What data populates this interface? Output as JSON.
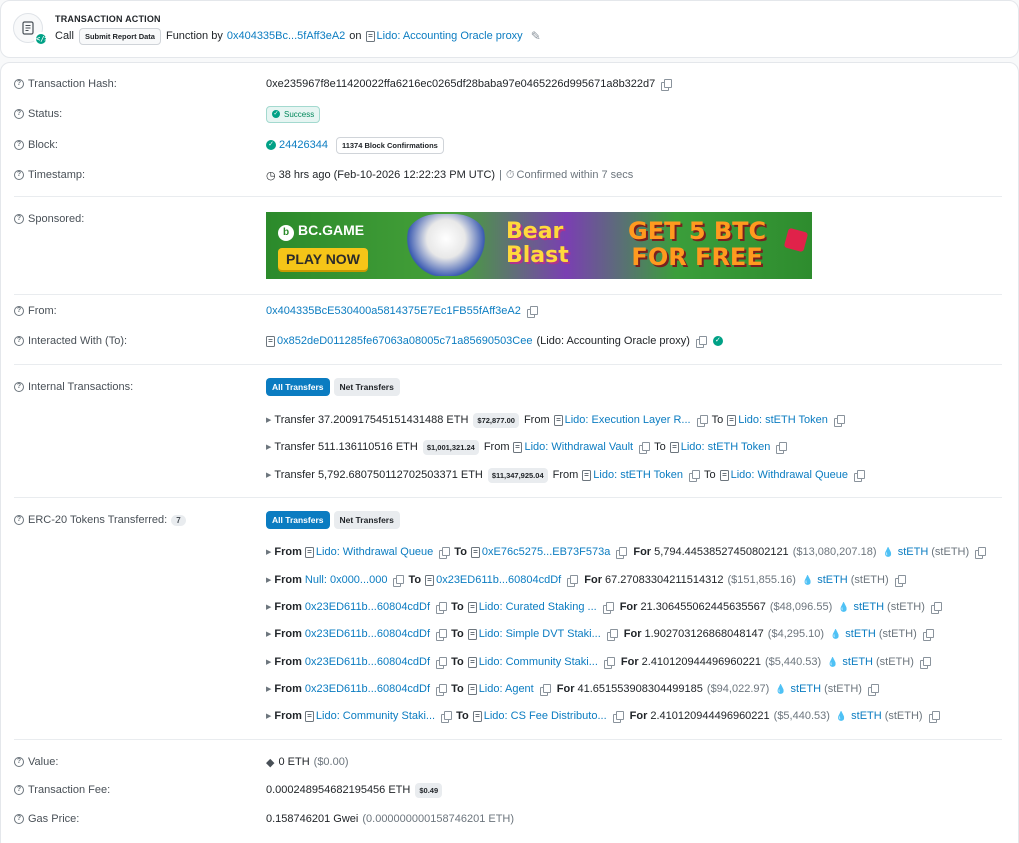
{
  "action": {
    "title": "TRANSACTION ACTION",
    "call": "Call",
    "method": "Submit Report Data",
    "function_by": "Function by",
    "from_addr": "0x404335Bc...5fAff3eA2",
    "on": "on",
    "contract": "Lido: Accounting Oracle proxy"
  },
  "labels": {
    "tx_hash": "Transaction Hash:",
    "status": "Status:",
    "block": "Block:",
    "timestamp": "Timestamp:",
    "sponsored": "Sponsored:",
    "from": "From:",
    "interacted": "Interacted With (To):",
    "internal": "Internal Transactions:",
    "erc20": "ERC-20 Tokens Transferred:",
    "value": "Value:",
    "fee": "Transaction Fee:",
    "gas": "Gas Price:"
  },
  "tx_hash": "0xe235967f8e11420022ffa6216ec0265df28baba97e0465226d995671a8b322d7",
  "status": "Success",
  "block": {
    "number": "24426344",
    "confirmations": "11374 Block Confirmations"
  },
  "timestamp": {
    "text": "38 hrs ago (Feb-10-2026 12:22:23 PM UTC)",
    "sep": "|",
    "confirmed": "Confirmed within 7 secs"
  },
  "ad": {
    "brand": "BC.GAME",
    "play": "PLAY NOW",
    "game_top": "Bear",
    "game_bottom": "Blast",
    "cta_1": "GET 5 BTC",
    "cta_2": "FOR FREE"
  },
  "from_address": "0x404335BcE530400a5814375E7Ec1FB55fAff3eA2",
  "to": {
    "address": "0x852deD011285fe67063a08005c71a85690503Cee",
    "name": "(Lido: Accounting Oracle proxy)"
  },
  "tabs": {
    "all": "All Transfers",
    "net": "Net Transfers"
  },
  "words": {
    "transfer": "Transfer",
    "from": "From",
    "to": "To",
    "for": "For"
  },
  "internal": [
    {
      "amount": "37.200917545151431488 ETH",
      "usd": "$72,877.00",
      "from": "Lido: Execution Layer R...",
      "to": "Lido: stETH Token"
    },
    {
      "amount": "511.136110516 ETH",
      "usd": "$1,001,321.24",
      "from": "Lido: Withdrawal Vault",
      "to": "Lido: stETH Token"
    },
    {
      "amount": "5,792.680750112702503371 ETH",
      "usd": "$11,347,925.04",
      "from": "Lido: stETH Token",
      "to": "Lido: Withdrawal Queue"
    }
  ],
  "erc20_count": "7",
  "erc20": [
    {
      "from": "Lido: Withdrawal Queue",
      "to": "0xE76c5275...EB73F573a",
      "amount": "5,794.44538527450802121",
      "usd": "($13,080,207.18)",
      "token": "stETH",
      "sym": "(stETH)"
    },
    {
      "from": "Null: 0x000...000",
      "to": "0x23ED611b...60804cdDf",
      "amount": "67.27083304211514312",
      "usd": "($151,855.16)",
      "token": "stETH",
      "sym": "(stETH)"
    },
    {
      "from": "0x23ED611b...60804cdDf",
      "to": "Lido: Curated Staking ...",
      "amount": "21.306455062445635567",
      "usd": "($48,096.55)",
      "token": "stETH",
      "sym": "(stETH)"
    },
    {
      "from": "0x23ED611b...60804cdDf",
      "to": "Lido: Simple DVT Staki...",
      "amount": "1.902703126868048147",
      "usd": "($4,295.10)",
      "token": "stETH",
      "sym": "(stETH)"
    },
    {
      "from": "0x23ED611b...60804cdDf",
      "to": "Lido: Community Staki...",
      "amount": "2.410120944496960221",
      "usd": "($5,440.53)",
      "token": "stETH",
      "sym": "(stETH)"
    },
    {
      "from": "0x23ED611b...60804cdDf",
      "to": "Lido: Agent",
      "amount": "41.651553908304499185",
      "usd": "($94,022.97)",
      "token": "stETH",
      "sym": "(stETH)"
    },
    {
      "from": "Lido: Community Staki...",
      "to": "Lido: CS Fee Distributo...",
      "amount": "2.410120944496960221",
      "usd": "($5,440.53)",
      "token": "stETH",
      "sym": "(stETH)"
    }
  ],
  "value": {
    "eth": "0 ETH",
    "usd": "($0.00)"
  },
  "fee": {
    "eth": "0.000248954682195456 ETH",
    "usd": "$0.49"
  },
  "gas": {
    "gwei": "0.158746201 Gwei",
    "eth": "(0.000000000158746201 ETH)"
  }
}
